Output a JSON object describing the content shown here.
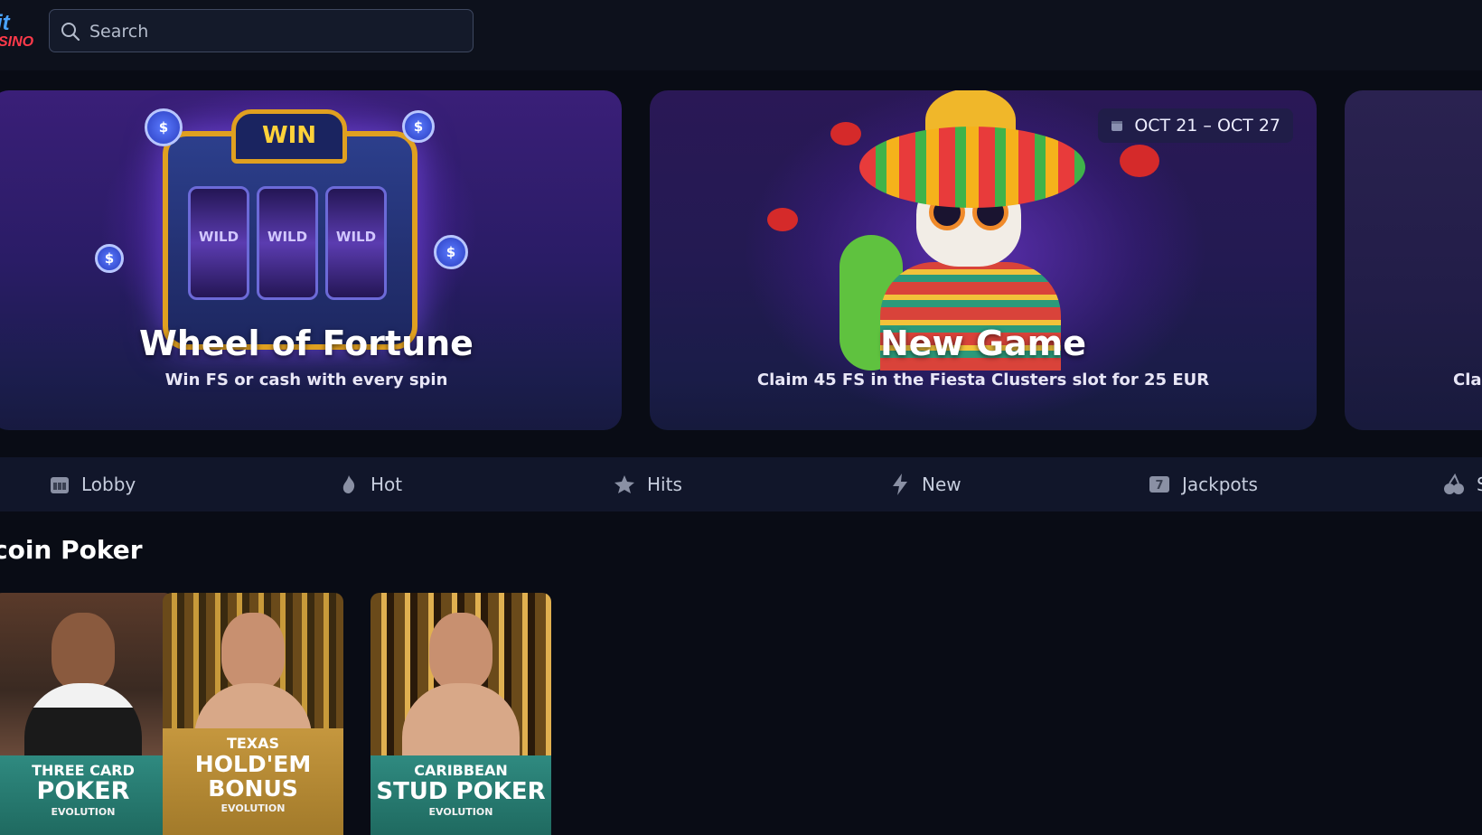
{
  "logo": {
    "line1": "it",
    "line2": "SINO"
  },
  "search": {
    "placeholder": "Search"
  },
  "banners": [
    {
      "title": "Wheel of Fortune",
      "subtitle": "Win FS or cash with every spin",
      "art_text": "WIN",
      "reel_text": "WILD"
    },
    {
      "title": "New Game",
      "subtitle": "Claim 45 FS in the Fiesta Clusters slot for 25 EUR",
      "date": "OCT 21 – OCT 27"
    },
    {
      "subtitle_partial": "Cla"
    }
  ],
  "categories": [
    {
      "label": "Lobby",
      "icon": "lobby-icon"
    },
    {
      "label": "Hot",
      "icon": "flame-icon"
    },
    {
      "label": "Hits",
      "icon": "star-icon"
    },
    {
      "label": "New",
      "icon": "lightning-icon"
    },
    {
      "label": "Jackpots",
      "icon": "jackpot-icon"
    },
    {
      "label": "S",
      "icon": "cherries-icon"
    }
  ],
  "section": {
    "title": "coin Poker"
  },
  "games": [
    {
      "line1": "THREE CARD",
      "line2": "POKER",
      "provider": "EVOLUTION"
    },
    {
      "line1": "TEXAS",
      "line2": "HOLD'EM BONUS",
      "provider": "EVOLUTION"
    },
    {
      "line1": "CARIBBEAN",
      "line2": "STUD POKER",
      "provider": "EVOLUTION"
    }
  ]
}
